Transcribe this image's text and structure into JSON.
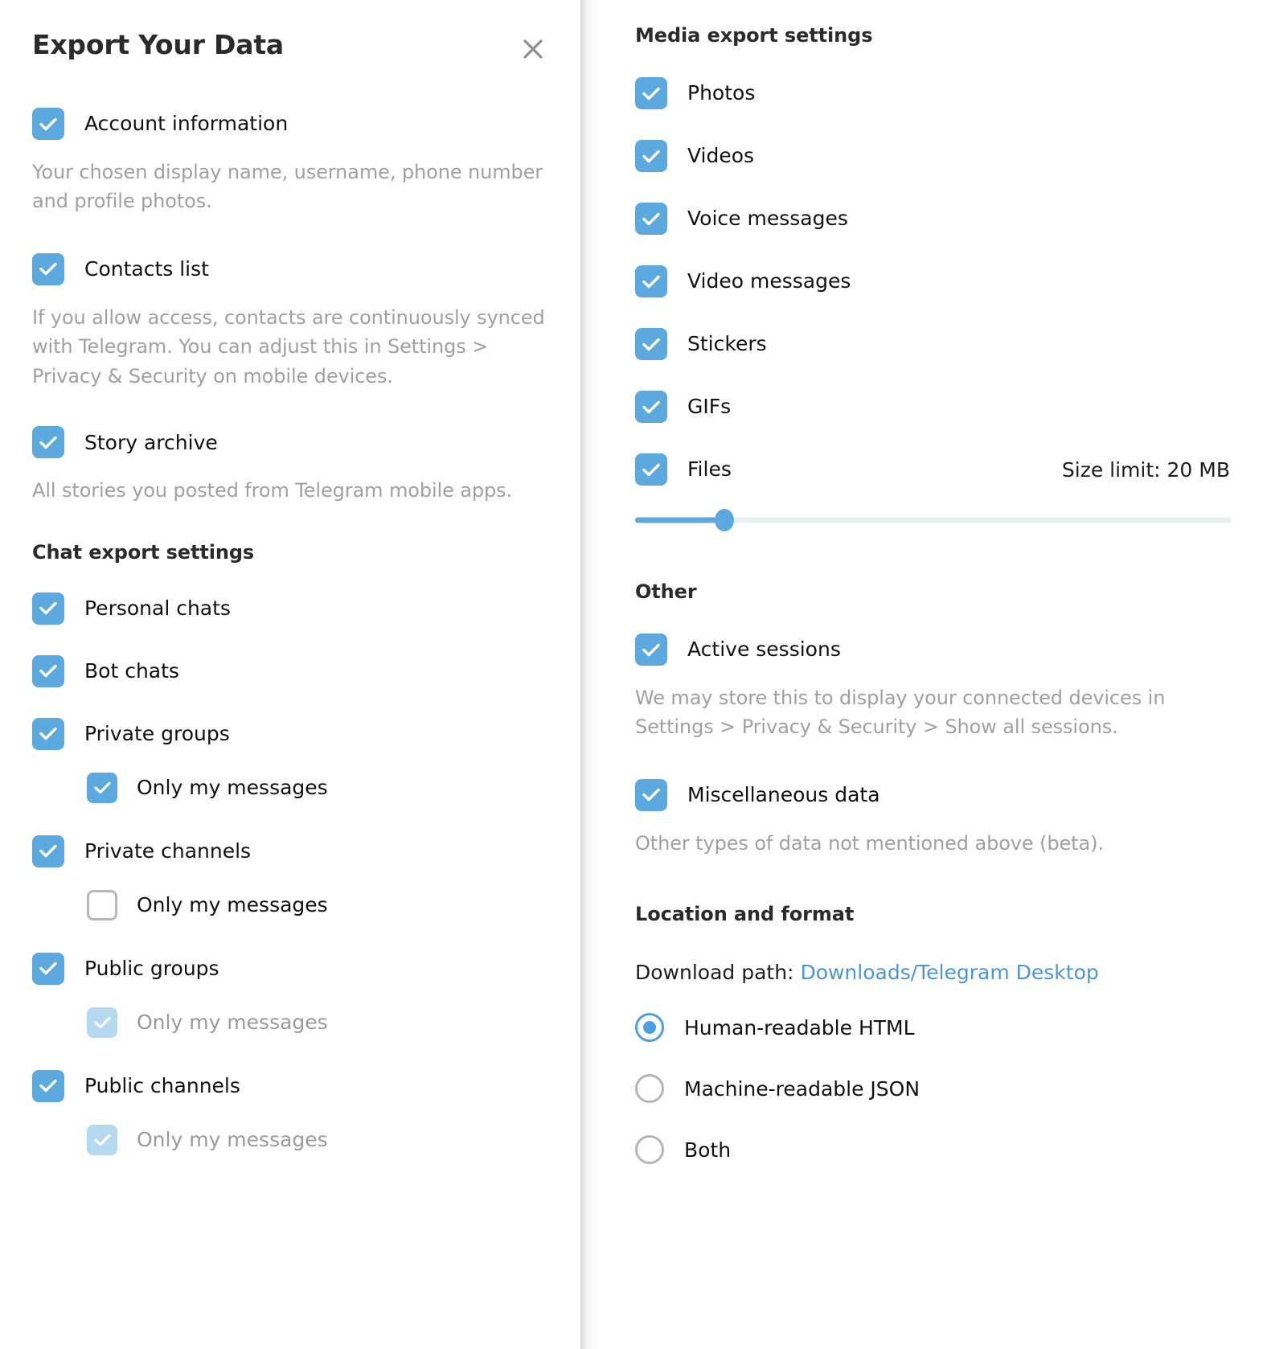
{
  "dialog": {
    "title": "Export Your Data",
    "close_icon": "close-icon"
  },
  "colors": {
    "accent": "#5ca9e0",
    "accent_link": "#4a96d8",
    "checkbox_checked": "#5ca9e0",
    "checkbox_disabled": "#b6d9f2",
    "checkbox_border": "#b8b8b8",
    "text_primary": "#111111",
    "text_muted": "#a0a0a0",
    "slider_track": "#eceff1",
    "radio_selected": "#4c9fe0"
  },
  "left": {
    "top_items": [
      {
        "label": "Account information",
        "checked": true,
        "description": "Your chosen display name, username, phone number and profile photos."
      },
      {
        "label": "Contacts list",
        "checked": true,
        "description": "If you allow access, contacts are continuously synced with Telegram. You can adjust this in Settings > Privacy & Security on mobile devices."
      },
      {
        "label": "Story archive",
        "checked": true,
        "description": "All stories you posted from Telegram mobile apps."
      }
    ],
    "chat_section": {
      "header": "Chat export settings",
      "items": [
        {
          "label": "Personal chats",
          "checked": true,
          "sub": null
        },
        {
          "label": "Bot chats",
          "checked": true,
          "sub": null
        },
        {
          "label": "Private groups",
          "checked": true,
          "sub": {
            "label": "Only my messages",
            "checked": true,
            "disabled": false
          }
        },
        {
          "label": "Private channels",
          "checked": true,
          "sub": {
            "label": "Only my messages",
            "checked": false,
            "disabled": false
          }
        },
        {
          "label": "Public groups",
          "checked": true,
          "sub": {
            "label": "Only my messages",
            "checked": true,
            "disabled": true
          }
        },
        {
          "label": "Public channels",
          "checked": true,
          "sub": {
            "label": "Only my messages",
            "checked": true,
            "disabled": true
          }
        }
      ]
    }
  },
  "right": {
    "media_section": {
      "header": "Media export settings",
      "items": [
        {
          "label": "Photos",
          "checked": true
        },
        {
          "label": "Videos",
          "checked": true
        },
        {
          "label": "Voice messages",
          "checked": true
        },
        {
          "label": "Video messages",
          "checked": true
        },
        {
          "label": "Stickers",
          "checked": true
        },
        {
          "label": "GIFs",
          "checked": true
        },
        {
          "label": "Files",
          "checked": true
        }
      ],
      "size_limit_label": "Size limit: 20 MB",
      "size_limit_value": 20,
      "size_limit_unit": "MB",
      "slider_percent": 15
    },
    "other_section": {
      "header": "Other",
      "items": [
        {
          "label": "Active sessions",
          "checked": true,
          "description": "We may store this to display your connected devices in Settings > Privacy & Security > Show all sessions."
        },
        {
          "label": "Miscellaneous data",
          "checked": true,
          "description": "Other types of data not mentioned above (beta)."
        }
      ]
    },
    "location_section": {
      "header": "Location and format",
      "download_path_label": "Download path:",
      "download_path_value": "Downloads/Telegram Desktop",
      "format_options": [
        {
          "label": "Human-readable HTML",
          "selected": true
        },
        {
          "label": "Machine-readable JSON",
          "selected": false
        },
        {
          "label": "Both",
          "selected": false
        }
      ]
    }
  }
}
